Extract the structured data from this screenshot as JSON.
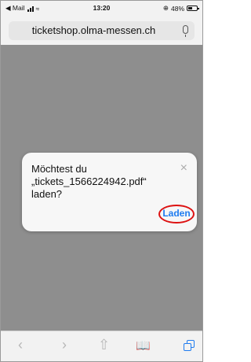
{
  "status_bar": {
    "back_app": "◀ Mail",
    "time": "13:20",
    "battery": "48%"
  },
  "url_bar": {
    "url": "ticketshop.olma-messen.ch"
  },
  "dialog": {
    "message": "Möchtest du\n„tickets_1566224942.pdf“\nladen?",
    "close_symbol": "×",
    "action_label": "Laden"
  },
  "toolbar": {
    "back_symbol": "‹",
    "forward_symbol": "›",
    "share_symbol": "⇧",
    "bookmarks_symbol": "📖",
    "tabs_icon": "tabs-icon"
  },
  "colors": {
    "accent": "#1f7cf0",
    "highlight": "#d11111",
    "overlay": "#8e8e8e"
  }
}
